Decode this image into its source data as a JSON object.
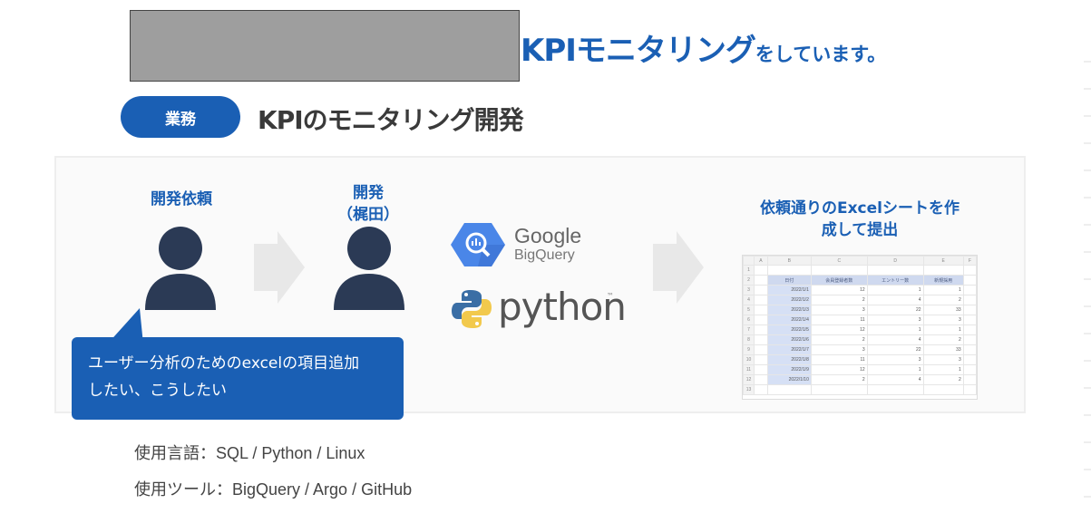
{
  "header": {
    "headline_main": "KPIモニタリング",
    "headline_suffix": "をしています。"
  },
  "section": {
    "badge": "業務",
    "title": "KPIのモニタリング開発"
  },
  "flow": {
    "step1_label": "開発依頼",
    "step2_label_line1": "開発",
    "step2_label_line2": "（梶田）",
    "step3_label_line1": "依頼通りのExcelシートを作",
    "step3_label_line2": "成して提出",
    "bubble_line1": "ユーザー分析のためのexcelの項目追加",
    "bubble_line2": "したい、こうしたい",
    "tools": {
      "google_text": "Google",
      "bigquery_text": "BigQuery",
      "python_text": "python",
      "python_tm": "™"
    }
  },
  "sheet": {
    "col_headers": [
      "",
      "A",
      "B",
      "C",
      "D",
      "E",
      "F"
    ],
    "header_row": [
      "日付",
      "会員登録者数",
      "エントリー数",
      "新規採用"
    ],
    "rows": [
      [
        "2022/1/1",
        "12",
        "1",
        "1"
      ],
      [
        "2022/1/2",
        "2",
        "4",
        "2"
      ],
      [
        "2022/1/3",
        "3",
        "22",
        "33"
      ],
      [
        "2022/1/4",
        "11",
        "3",
        "3"
      ],
      [
        "2022/1/5",
        "12",
        "1",
        "1"
      ],
      [
        "2022/1/6",
        "2",
        "4",
        "2"
      ],
      [
        "2022/1/7",
        "3",
        "22",
        "33"
      ],
      [
        "2022/1/8",
        "11",
        "3",
        "3"
      ],
      [
        "2022/1/9",
        "12",
        "1",
        "1"
      ],
      [
        "2022/1/10",
        "2",
        "4",
        "2"
      ]
    ]
  },
  "info": {
    "languages": "使用言語：SQL / Python / Linux",
    "tools": "使用ツール：BigQuery / Argo / GitHub"
  },
  "colors": {
    "accent": "#1a5fb4",
    "person": "#2b3a55",
    "arrow": "#e8e8e8"
  }
}
